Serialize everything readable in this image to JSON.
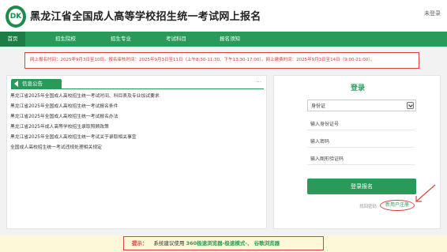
{
  "header": {
    "logo_text": "DK",
    "title": "黑龙江省全国成人高等学校招生统一考试网上报名",
    "login_link": "未登录"
  },
  "nav": {
    "items": [
      {
        "label": "首页",
        "active": true
      },
      {
        "label": "招生院校",
        "active": false
      },
      {
        "label": "招生专业",
        "active": false
      },
      {
        "label": "考试科目",
        "active": false
      },
      {
        "label": "报名须知",
        "active": false
      }
    ]
  },
  "notice": {
    "text": "网上报名时间：2025年9月3日至10日。报名审核时间：2025年9月3日至11日（上午8:30-11:30、下午13:30-17:00）。网上缴费时间：2025年9月3日至14日（9:00-21:00）。"
  },
  "news": {
    "tab_label": "信息公告",
    "more": "...",
    "items": [
      "黑龙江省2025年全国成人高校招生统一考试时间、科目表及专业加试要求",
      "黑龙江省2025年全国成人高校招生统一考试报名条件",
      "黑龙江省2025年全国成人高校招生统一考试报名办法",
      "黑龙江省2025年成人高等学校招生录取照顾政策",
      "黑龙江省2025年全国成人高校招生统一考试关于录取相关事宜",
      "全国成人高校招生统一考试违规处理相关规定"
    ]
  },
  "login": {
    "title": "登录",
    "id_type": "身份证",
    "id_number_placeholder": "输入身份证号",
    "password_placeholder": "输入密码",
    "captcha_placeholder": "输入图形验证码",
    "submit_label": "登录报名",
    "forgot_label": "找回密码",
    "register_label": "新用户注册"
  },
  "footer": {
    "tip_label": "提示：",
    "tip_text": "系统建议使用",
    "tip_browser1": "360极速浏览器-极速模式-",
    "tip_sep": "、",
    "tip_browser2": "谷歌浏览器"
  },
  "colors": {
    "brand_green": "#2a9a5a",
    "annotation_red": "#e04040"
  }
}
